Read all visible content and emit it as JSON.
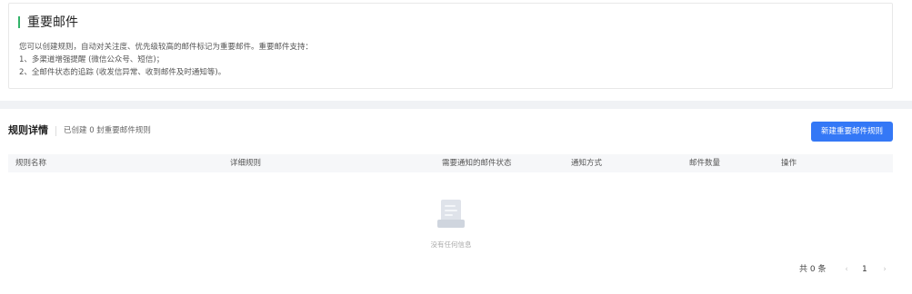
{
  "info": {
    "title": "重要邮件",
    "line1": "您可以创建规则，自动对关注度、优先级较高的邮件标记为重要邮件。重要邮件支持：",
    "line2": "1、多渠道增强提醒 (微信公众号、短信)；",
    "line3": "2、全邮件状态的追踪 (收发信异常、收到邮件及时通知等)。",
    "accent_color": "#33b36a"
  },
  "rules": {
    "title": "规则详情",
    "subtitle": "已创建 0 封重要邮件规则",
    "new_button": "新建重要邮件规则",
    "button_color": "#3478f6",
    "columns": [
      "规则名称",
      "详细规则",
      "需要通知的邮件状态",
      "通知方式",
      "邮件数量",
      "操作"
    ],
    "empty_icon": "document-icon",
    "empty_text": "没有任何信息"
  },
  "pagination": {
    "total": "共 0 条",
    "current_page": "1",
    "prev_icon": "chevron-left-icon",
    "next_icon": "chevron-right-icon"
  }
}
